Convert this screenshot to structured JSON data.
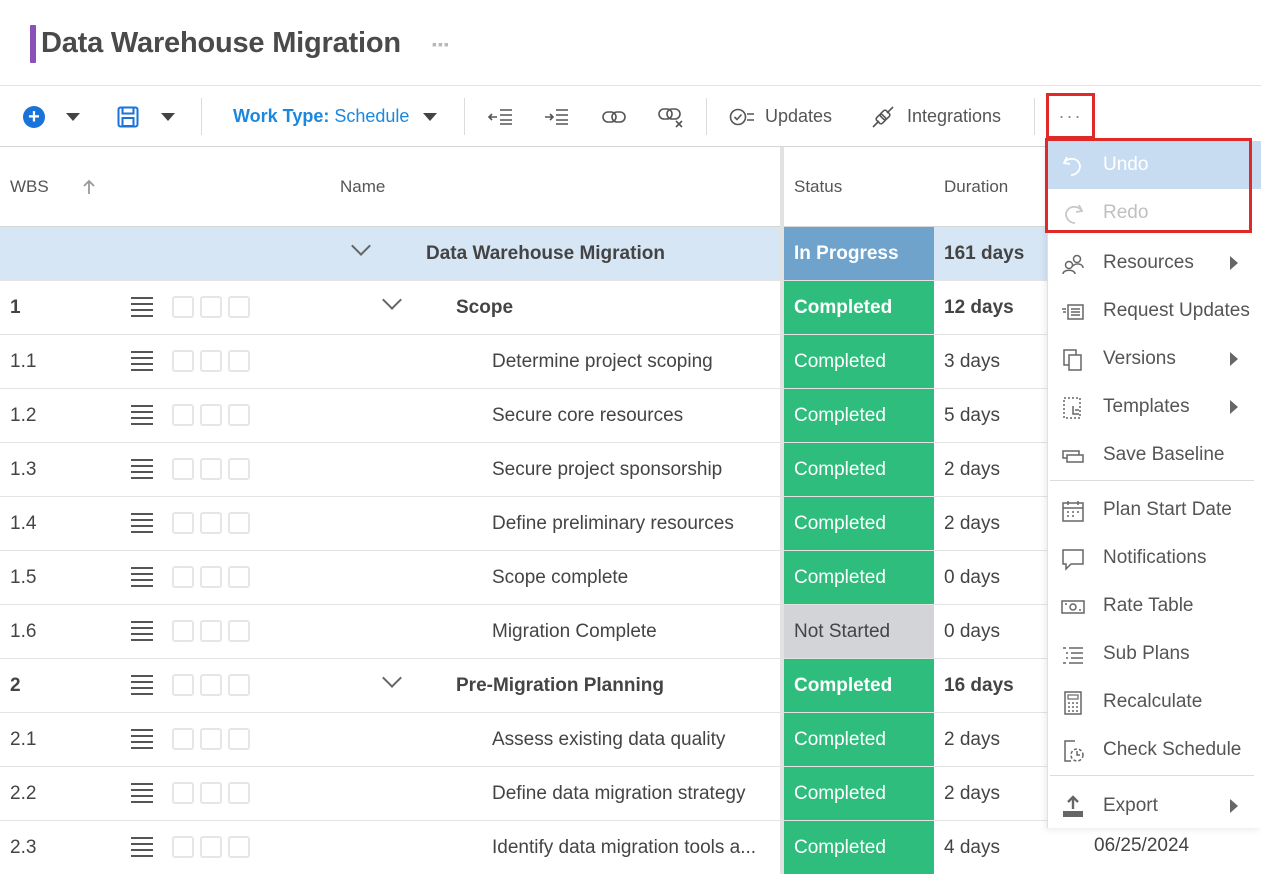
{
  "title": "Data Warehouse Migration",
  "toolbar": {
    "work_type_label": "Work Type:",
    "work_type_value": "Schedule",
    "updates_label": "Updates",
    "integrations_label": "Integrations",
    "more_label": "···"
  },
  "columns": {
    "wbs": "WBS",
    "name": "Name",
    "status": "Status",
    "duration": "Duration"
  },
  "rows": [
    {
      "wbs": "",
      "name": "Data Warehouse Migration",
      "status": "In Progress",
      "duration": "161 days"
    },
    {
      "wbs": "1",
      "name": "Scope",
      "status": "Completed",
      "duration": "12 days"
    },
    {
      "wbs": "1.1",
      "name": "Determine project scoping",
      "status": "Completed",
      "duration": "3 days"
    },
    {
      "wbs": "1.2",
      "name": "Secure core resources",
      "status": "Completed",
      "duration": "5 days"
    },
    {
      "wbs": "1.3",
      "name": "Secure project sponsorship",
      "status": "Completed",
      "duration": "2 days"
    },
    {
      "wbs": "1.4",
      "name": "Define preliminary resources",
      "status": "Completed",
      "duration": "2 days"
    },
    {
      "wbs": "1.5",
      "name": "Scope complete",
      "status": "Completed",
      "duration": "0 days"
    },
    {
      "wbs": "1.6",
      "name": "Migration Complete",
      "status": "Not Started",
      "duration": "0 days"
    },
    {
      "wbs": "2",
      "name": "Pre-Migration Planning",
      "status": "Completed",
      "duration": "16 days"
    },
    {
      "wbs": "2.1",
      "name": "Assess existing data quality",
      "status": "Completed",
      "duration": "2 days"
    },
    {
      "wbs": "2.2",
      "name": "Define data migration strategy",
      "status": "Completed",
      "duration": "2 days"
    },
    {
      "wbs": "2.3",
      "name": "Identify data migration tools a...",
      "status": "Completed",
      "duration": "4 days"
    }
  ],
  "visible_date": "06/25/2024",
  "menu": {
    "undo": "Undo",
    "redo": "Redo",
    "resources": "Resources",
    "request_updates": "Request Updates",
    "versions": "Versions",
    "templates": "Templates",
    "save_baseline": "Save Baseline",
    "plan_start_date": "Plan Start Date",
    "notifications": "Notifications",
    "rate_table": "Rate Table",
    "sub_plans": "Sub Plans",
    "recalculate": "Recalculate",
    "check_schedule": "Check Schedule",
    "export": "Export"
  },
  "colors": {
    "accent": "#8b4fb8",
    "primary_blue": "#1a73d8",
    "completed": "#2ebd7c",
    "in_progress": "#6fa3cc",
    "not_started": "#d3d4d8",
    "highlight_border": "#e02a2a"
  }
}
